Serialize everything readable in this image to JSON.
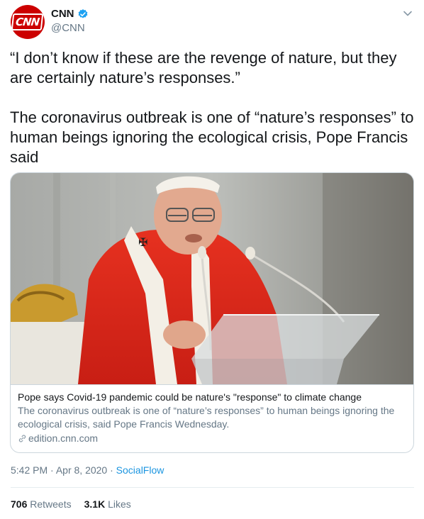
{
  "author": {
    "display_name": "CNN",
    "handle": "@CNN",
    "avatar_text": "CNN",
    "verified": true
  },
  "tweet": {
    "paragraph_1": "“I don’t know if these are the revenge of nature, but they are certainly nature’s responses.”",
    "paragraph_2": "The coronavirus outbreak is one of “nature’s responses” to human beings ignoring the ecological crisis, Pope Francis said"
  },
  "card": {
    "title": "Pope says Covid-19 pandemic could be nature's \"response\" to climate change",
    "description": "The coronavirus outbreak is one of “nature’s responses” to human beings ignoring the ecological crisis, said Pope Francis Wednesday.",
    "domain": "edition.cnn.com"
  },
  "meta": {
    "time": "5:42 PM",
    "date": "Apr 8, 2020",
    "source": "SocialFlow",
    "separator": "·"
  },
  "stats": {
    "retweets_count": "706",
    "retweets_label": "Retweets",
    "likes_count": "3.1K",
    "likes_label": "Likes"
  },
  "colors": {
    "brand_red": "#cc0000",
    "link_blue": "#1b95e0",
    "verified_blue": "#1da1f2",
    "secondary_text": "#657786"
  },
  "icons": [
    "verified-icon",
    "chevron-down-icon",
    "link-icon"
  ]
}
